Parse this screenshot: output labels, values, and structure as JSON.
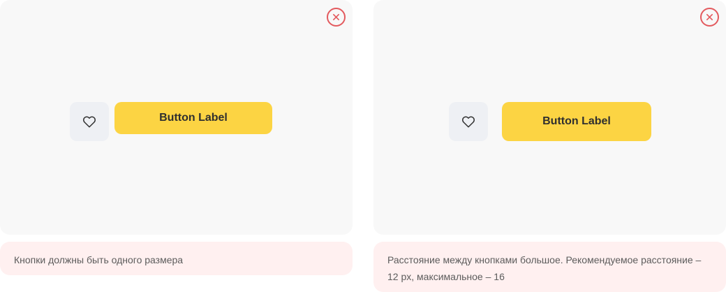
{
  "examples": [
    {
      "button_label": "Button Label",
      "note": "Кнопки должны быть одного размера"
    },
    {
      "button_label": "Button Label",
      "note": "Расстояние между кнопками большое. Рекомендуемое расстояние – 12 px, максимальное – 16"
    }
  ],
  "icons": {
    "status": "close-icon",
    "favorite": "heart-icon"
  },
  "colors": {
    "card_bg": "#f8f8f8",
    "note_bg": "#fff0f0",
    "error_red": "#e35a5e",
    "primary_yellow": "#fcd443",
    "secondary_gray": "#eef0f4",
    "text_dark": "#2f2f2f",
    "text_muted": "#5c5c5c"
  }
}
